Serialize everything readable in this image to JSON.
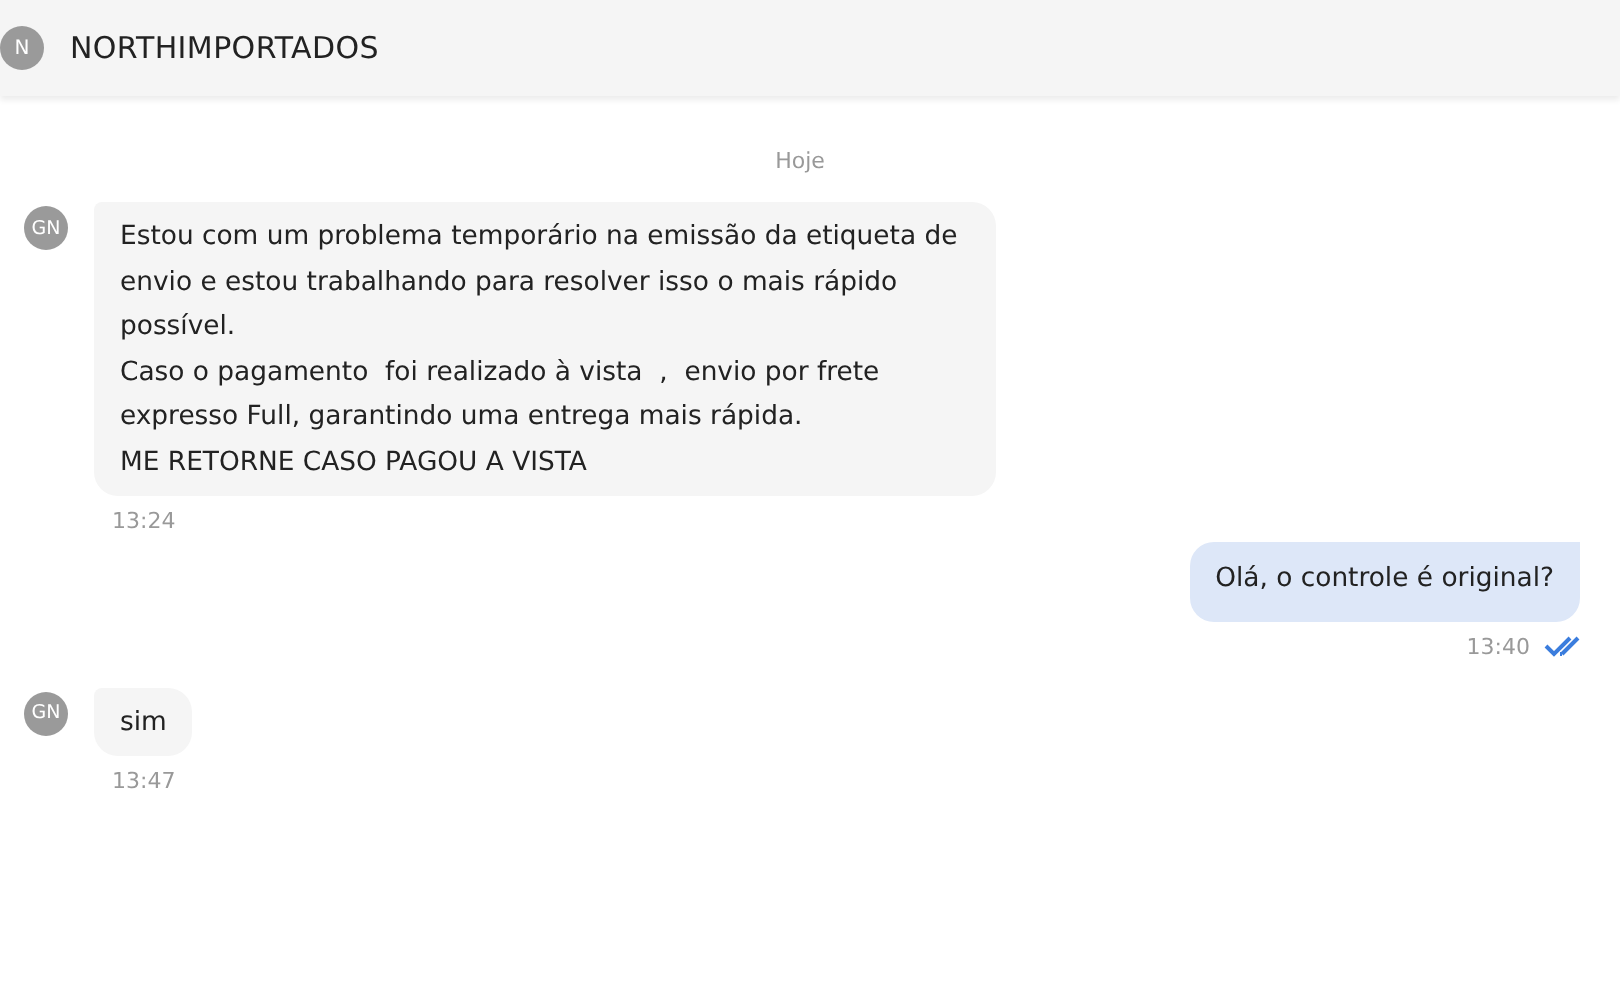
{
  "header": {
    "avatar": "N",
    "title": "NORTHIMPORTADOS"
  },
  "day_separator": "Hoje",
  "messages": [
    {
      "kind": "received",
      "avatar": "GN",
      "text": "Estou com um problema temporário na emissão da etiqueta de envio e estou trabalhando para resolver isso o mais rápido possível.\nCaso o pagamento  foi realizado à vista  ,  envio por frete expresso Full, garantindo uma entrega mais rápida.\nME RETORNE CASO PAGOU A VISTA",
      "time": "13:24"
    },
    {
      "kind": "sent",
      "text": "Olá, o controle é original?",
      "time": "13:40",
      "read": true
    },
    {
      "kind": "received",
      "avatar": "GN",
      "text": "sim",
      "time": "13:47"
    }
  ]
}
